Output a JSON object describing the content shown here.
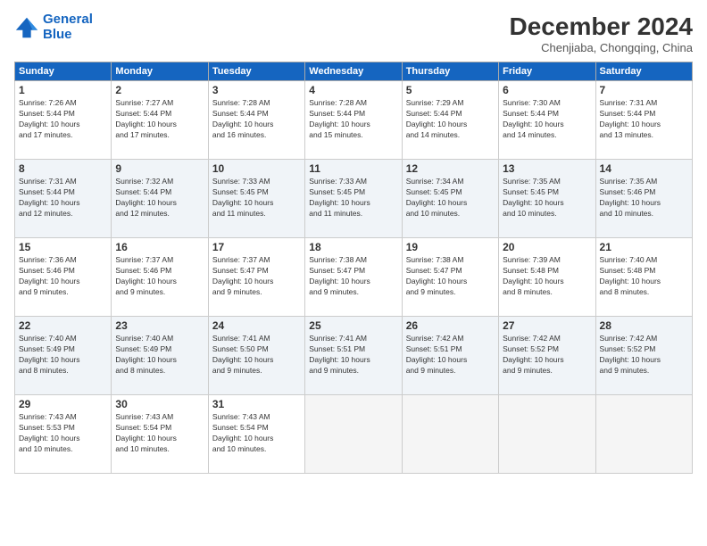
{
  "logo": {
    "line1": "General",
    "line2": "Blue"
  },
  "title": "December 2024",
  "subtitle": "Chenjiaba, Chongqing, China",
  "weekdays": [
    "Sunday",
    "Monday",
    "Tuesday",
    "Wednesday",
    "Thursday",
    "Friday",
    "Saturday"
  ],
  "weeks": [
    [
      {
        "day": "1",
        "info": "Sunrise: 7:26 AM\nSunset: 5:44 PM\nDaylight: 10 hours\nand 17 minutes."
      },
      {
        "day": "2",
        "info": "Sunrise: 7:27 AM\nSunset: 5:44 PM\nDaylight: 10 hours\nand 17 minutes."
      },
      {
        "day": "3",
        "info": "Sunrise: 7:28 AM\nSunset: 5:44 PM\nDaylight: 10 hours\nand 16 minutes."
      },
      {
        "day": "4",
        "info": "Sunrise: 7:28 AM\nSunset: 5:44 PM\nDaylight: 10 hours\nand 15 minutes."
      },
      {
        "day": "5",
        "info": "Sunrise: 7:29 AM\nSunset: 5:44 PM\nDaylight: 10 hours\nand 14 minutes."
      },
      {
        "day": "6",
        "info": "Sunrise: 7:30 AM\nSunset: 5:44 PM\nDaylight: 10 hours\nand 14 minutes."
      },
      {
        "day": "7",
        "info": "Sunrise: 7:31 AM\nSunset: 5:44 PM\nDaylight: 10 hours\nand 13 minutes."
      }
    ],
    [
      {
        "day": "8",
        "info": "Sunrise: 7:31 AM\nSunset: 5:44 PM\nDaylight: 10 hours\nand 12 minutes."
      },
      {
        "day": "9",
        "info": "Sunrise: 7:32 AM\nSunset: 5:44 PM\nDaylight: 10 hours\nand 12 minutes."
      },
      {
        "day": "10",
        "info": "Sunrise: 7:33 AM\nSunset: 5:45 PM\nDaylight: 10 hours\nand 11 minutes."
      },
      {
        "day": "11",
        "info": "Sunrise: 7:33 AM\nSunset: 5:45 PM\nDaylight: 10 hours\nand 11 minutes."
      },
      {
        "day": "12",
        "info": "Sunrise: 7:34 AM\nSunset: 5:45 PM\nDaylight: 10 hours\nand 10 minutes."
      },
      {
        "day": "13",
        "info": "Sunrise: 7:35 AM\nSunset: 5:45 PM\nDaylight: 10 hours\nand 10 minutes."
      },
      {
        "day": "14",
        "info": "Sunrise: 7:35 AM\nSunset: 5:46 PM\nDaylight: 10 hours\nand 10 minutes."
      }
    ],
    [
      {
        "day": "15",
        "info": "Sunrise: 7:36 AM\nSunset: 5:46 PM\nDaylight: 10 hours\nand 9 minutes."
      },
      {
        "day": "16",
        "info": "Sunrise: 7:37 AM\nSunset: 5:46 PM\nDaylight: 10 hours\nand 9 minutes."
      },
      {
        "day": "17",
        "info": "Sunrise: 7:37 AM\nSunset: 5:47 PM\nDaylight: 10 hours\nand 9 minutes."
      },
      {
        "day": "18",
        "info": "Sunrise: 7:38 AM\nSunset: 5:47 PM\nDaylight: 10 hours\nand 9 minutes."
      },
      {
        "day": "19",
        "info": "Sunrise: 7:38 AM\nSunset: 5:47 PM\nDaylight: 10 hours\nand 9 minutes."
      },
      {
        "day": "20",
        "info": "Sunrise: 7:39 AM\nSunset: 5:48 PM\nDaylight: 10 hours\nand 8 minutes."
      },
      {
        "day": "21",
        "info": "Sunrise: 7:40 AM\nSunset: 5:48 PM\nDaylight: 10 hours\nand 8 minutes."
      }
    ],
    [
      {
        "day": "22",
        "info": "Sunrise: 7:40 AM\nSunset: 5:49 PM\nDaylight: 10 hours\nand 8 minutes."
      },
      {
        "day": "23",
        "info": "Sunrise: 7:40 AM\nSunset: 5:49 PM\nDaylight: 10 hours\nand 8 minutes."
      },
      {
        "day": "24",
        "info": "Sunrise: 7:41 AM\nSunset: 5:50 PM\nDaylight: 10 hours\nand 9 minutes."
      },
      {
        "day": "25",
        "info": "Sunrise: 7:41 AM\nSunset: 5:51 PM\nDaylight: 10 hours\nand 9 minutes."
      },
      {
        "day": "26",
        "info": "Sunrise: 7:42 AM\nSunset: 5:51 PM\nDaylight: 10 hours\nand 9 minutes."
      },
      {
        "day": "27",
        "info": "Sunrise: 7:42 AM\nSunset: 5:52 PM\nDaylight: 10 hours\nand 9 minutes."
      },
      {
        "day": "28",
        "info": "Sunrise: 7:42 AM\nSunset: 5:52 PM\nDaylight: 10 hours\nand 9 minutes."
      }
    ],
    [
      {
        "day": "29",
        "info": "Sunrise: 7:43 AM\nSunset: 5:53 PM\nDaylight: 10 hours\nand 10 minutes."
      },
      {
        "day": "30",
        "info": "Sunrise: 7:43 AM\nSunset: 5:54 PM\nDaylight: 10 hours\nand 10 minutes."
      },
      {
        "day": "31",
        "info": "Sunrise: 7:43 AM\nSunset: 5:54 PM\nDaylight: 10 hours\nand 10 minutes."
      },
      {
        "day": "",
        "info": ""
      },
      {
        "day": "",
        "info": ""
      },
      {
        "day": "",
        "info": ""
      },
      {
        "day": "",
        "info": ""
      }
    ]
  ]
}
